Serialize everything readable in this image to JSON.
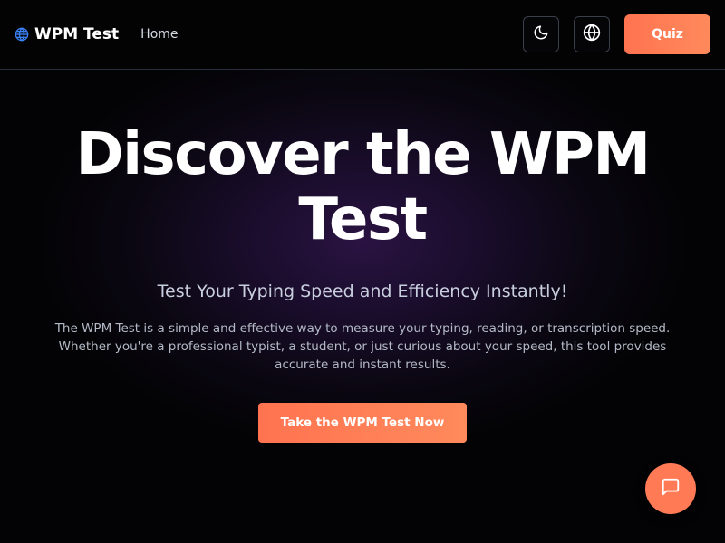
{
  "nav": {
    "logo_text": "WPM Test",
    "logo_icon": "globe-icon",
    "home_label": "Home",
    "theme_icon": "moon-icon",
    "language_icon": "globe-icon",
    "quiz_label": "Quiz"
  },
  "hero": {
    "title": "Discover the WPM Test",
    "subtitle": "Test Your Typing Speed and Efficiency Instantly!",
    "description": "The WPM Test is a simple and effective way to measure your typing, reading, or transcription speed. Whether you're a professional typist, a student, or just curious about your speed, this tool provides accurate and instant results.",
    "cta_label": "Take the WPM Test Now"
  },
  "chat": {
    "icon": "chat-icon"
  },
  "colors": {
    "accent": "#ff7a55",
    "background": "#030305",
    "hero_glow": "#2a1342"
  }
}
